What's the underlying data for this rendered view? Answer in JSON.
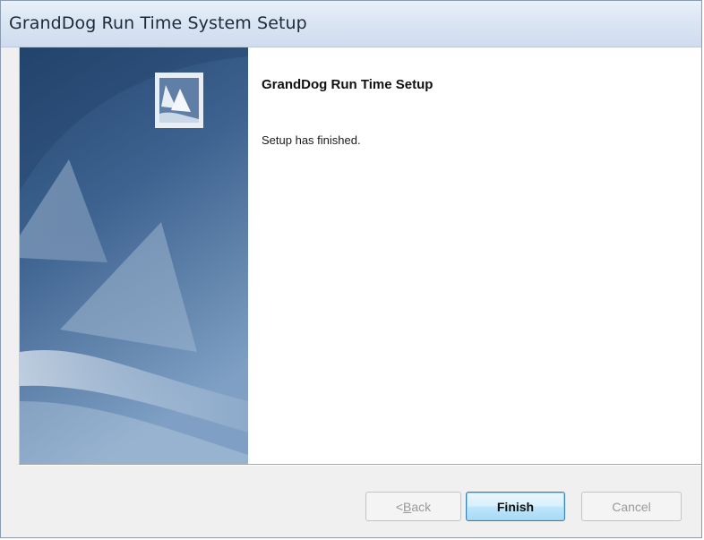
{
  "window": {
    "title": "GrandDog Run Time System Setup"
  },
  "main": {
    "heading": "GrandDog Run Time Setup",
    "message": "Setup has finished."
  },
  "side_panel": {
    "logo_icon": "installer-sails-logo",
    "colors": {
      "top": "#2a4d78",
      "bottom": "#6d8fb5",
      "logo_frame": "#e9eef4"
    }
  },
  "buttons": {
    "back": {
      "prefix": "< ",
      "mnemonic": "B",
      "rest": "ack",
      "enabled": false
    },
    "finish": {
      "label": "Finish",
      "default": true
    },
    "cancel": {
      "label": "Cancel",
      "enabled": false
    }
  }
}
